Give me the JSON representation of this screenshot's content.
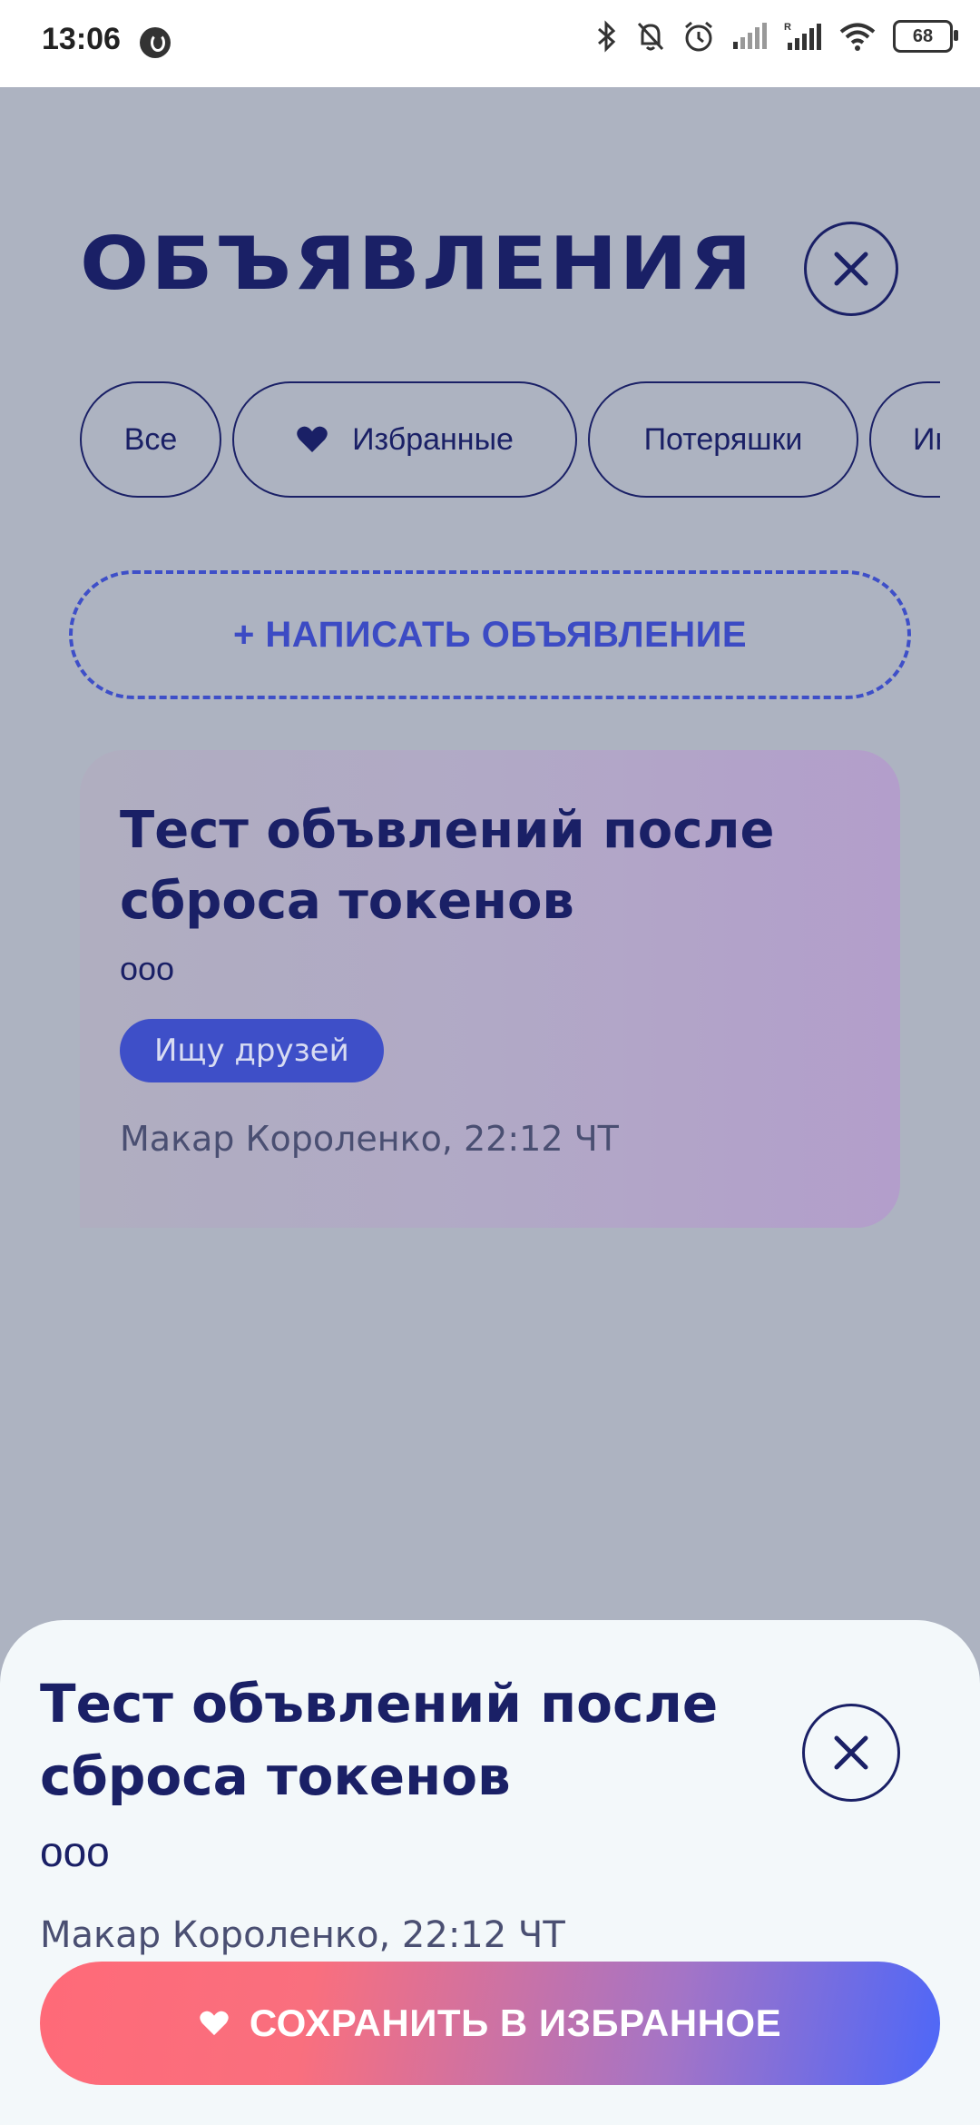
{
  "status_bar": {
    "time": "13:06",
    "battery": "68"
  },
  "header": {
    "title": "ОБЪЯВЛЕНИЯ"
  },
  "filters": {
    "chips": [
      {
        "label": "Все"
      },
      {
        "label": "Избранные",
        "icon": "heart-icon"
      },
      {
        "label": "Потеряшки"
      },
      {
        "label": "Ин"
      }
    ]
  },
  "write_button": {
    "label": "+ НАПИСАТЬ ОБЪЯВЛЕНИЕ"
  },
  "card": {
    "title": "Тест объвлений после сброса токенов",
    "description": "ооо",
    "tag": "Ищу друзей",
    "meta": "Макар Короленко, 22:12 ЧТ"
  },
  "sheet": {
    "title": "Тест объвлений после сброса токенов",
    "description": "ооо",
    "meta": "Макар Короленко, 22:12 ЧТ",
    "save_label": "СОХРАНИТЬ В ИЗБРАННОЕ"
  },
  "colors": {
    "accent": "#1a2066",
    "primary_blue": "#3e4fc8",
    "overlay_bg": "#adb3c1",
    "gradient_start": "#ff6a78",
    "gradient_end": "#4d67f8"
  }
}
